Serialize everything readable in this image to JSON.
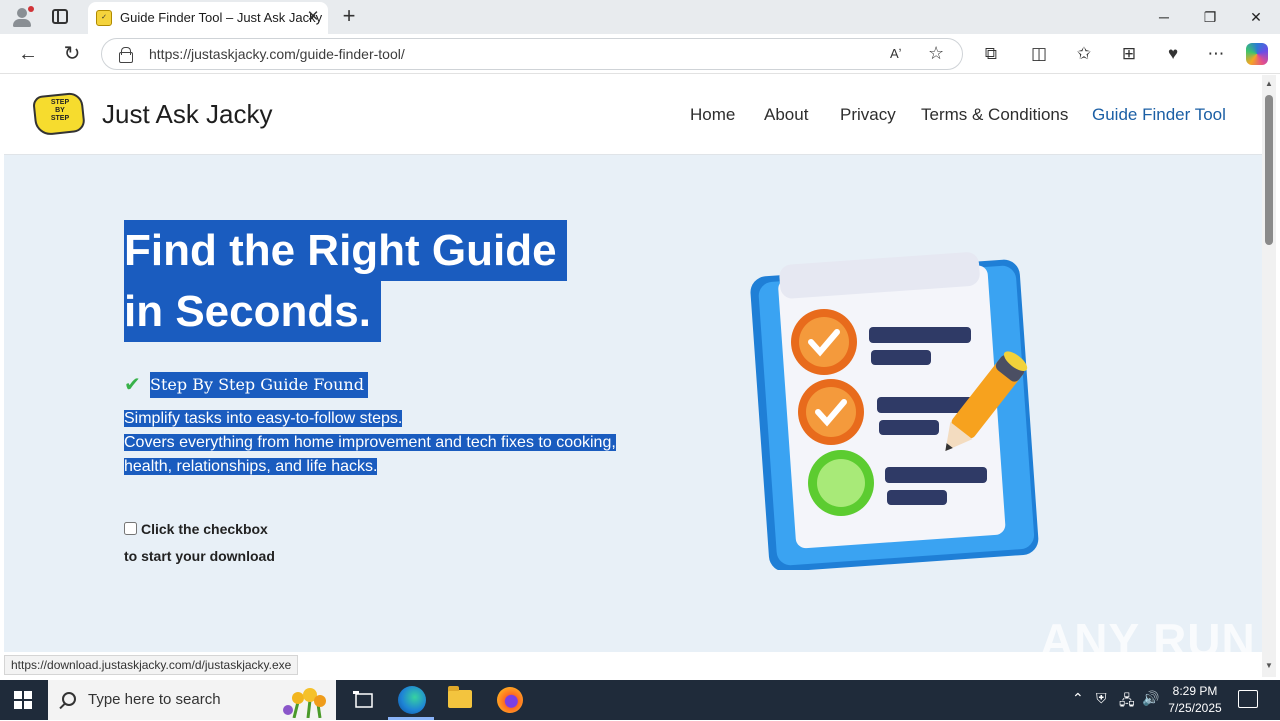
{
  "browser": {
    "tab_title": "Guide Finder Tool – Just Ask Jacky",
    "url": "https://justaskjacky.com/guide-finder-tool/",
    "status_url": "https://download.justaskjacky.com/d/justaskjacky.exe"
  },
  "site": {
    "name": "Just Ask Jacky",
    "logo_text": "STEP BY STEP",
    "nav": [
      {
        "label": "Home"
      },
      {
        "label": "About"
      },
      {
        "label": "Privacy"
      },
      {
        "label": "Terms & Conditions"
      },
      {
        "label": "Guide Finder Tool",
        "active": true
      }
    ],
    "accent_color": "#1b5fa5",
    "highlight_color": "#1a5cbf"
  },
  "hero": {
    "title_line1": "Find the Right Guide",
    "title_line2": "in Seconds.",
    "found_label": "Step By Step Guide Found",
    "desc_line1": "Simplify tasks into easy-to-follow steps.",
    "desc_line2": "Covers everything from home improvement and tech fixes to cooking,",
    "desc_line3": "health, relationships, and life hacks.",
    "checkbox_label": "Click the checkbox",
    "checkbox_sub": "to start your download",
    "checkbox_checked": false
  },
  "watermark": "ANY RUN",
  "taskbar": {
    "search_placeholder": "Type here to search",
    "time": "8:29 PM",
    "date": "7/25/2025"
  }
}
